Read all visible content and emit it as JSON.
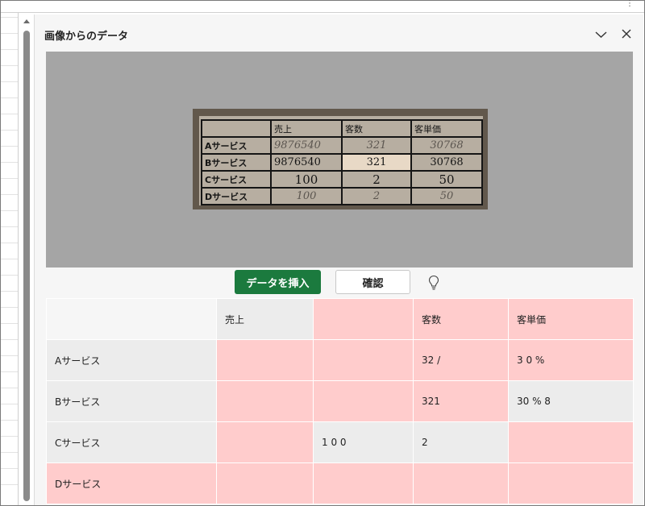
{
  "pane": {
    "title": "画像からのデータ",
    "icons": {
      "collapse": "chevron-down-icon",
      "close": "close-icon",
      "hint": "lightbulb-icon"
    }
  },
  "image": {
    "header": [
      "",
      "売上",
      "客数",
      "客単価"
    ],
    "rows": [
      [
        "Aサービス",
        "9876540",
        "321",
        "30768"
      ],
      [
        "Bサービス",
        "9876540",
        "321",
        "30768"
      ],
      [
        "Cサービス",
        "100",
        "2",
        "50"
      ],
      [
        "Dサービス",
        "100",
        "2",
        "50"
      ]
    ]
  },
  "actions": {
    "insert_label": "データを挿入",
    "confirm_label": "確認"
  },
  "result": {
    "header": [
      "",
      "売上",
      "",
      "客数",
      "客単価"
    ],
    "rows": [
      [
        "Aサービス",
        "",
        "",
        "32 /",
        "3 0 %"
      ],
      [
        "Bサービス",
        "",
        "",
        "321",
        "30 % 8"
      ],
      [
        "Cサービス",
        "",
        "1 0 0",
        "2",
        ""
      ],
      [
        "Dサービス",
        "",
        "",
        "",
        ""
      ]
    ]
  },
  "colors": {
    "accent_green": "#1b7a3e",
    "flag_pink": "#ffcccc",
    "cell_gray": "#ececec"
  }
}
